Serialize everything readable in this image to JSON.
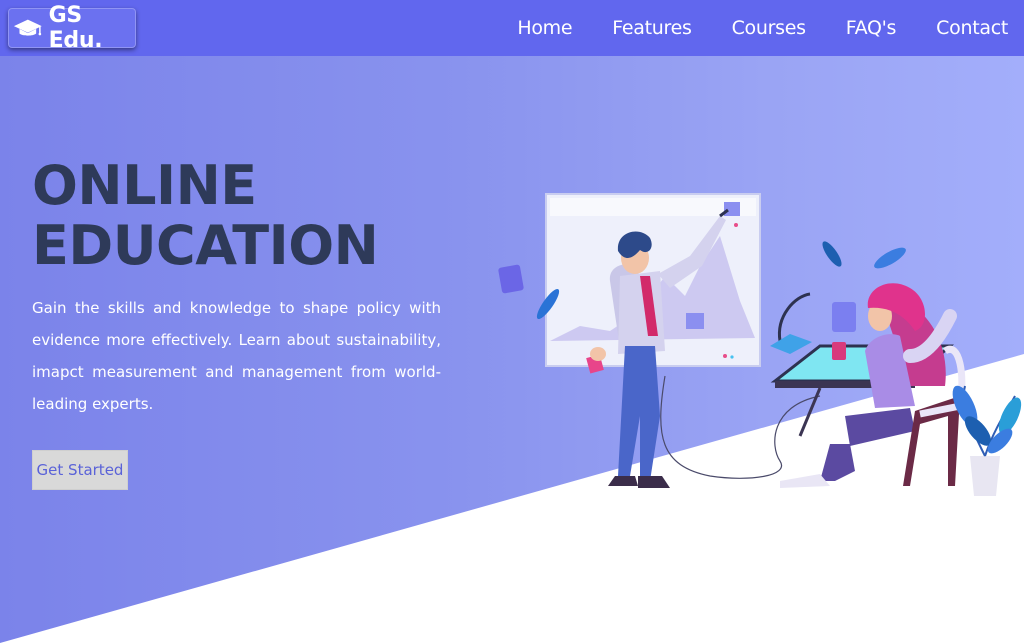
{
  "brand": {
    "name": "GS Edu.",
    "icon": "graduation-cap-icon"
  },
  "nav": {
    "links": [
      "Home",
      "Features",
      "Courses",
      "FAQ's",
      "Contact"
    ]
  },
  "hero": {
    "title_line1": "ONLINE",
    "title_line2": "EDUCATION",
    "description": "Gain the skills and knowledge to shape policy with evidence more effectively. Learn about sustainability, imapct measurement and management from world-leading experts.",
    "cta_label": "Get Started"
  },
  "colors": {
    "navbar": "#6167ee",
    "hero_gradient_start": "#7b83ea",
    "hero_gradient_end": "#a3aefb",
    "title": "#2e3a59",
    "cta_background": "#d9d9d9",
    "cta_text": "#5a62d8"
  },
  "illustration": {
    "subject": "teacher-at-whiteboard-and-student-at-desk"
  }
}
